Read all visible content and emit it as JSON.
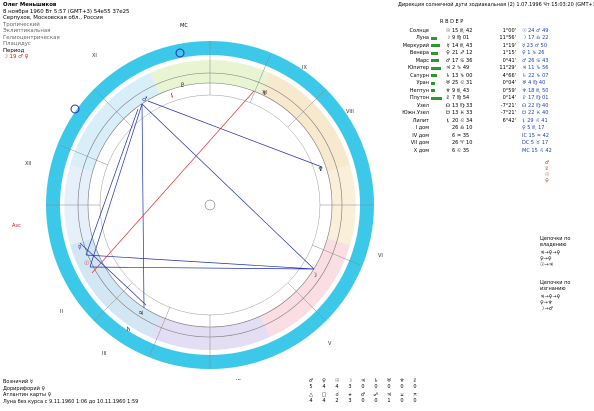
{
  "header": {
    "name": "Олег Меньшиков",
    "line1": "8 ноября 1960  Вт  5:57 (GMT+3) 54е55 37е25",
    "line2": "Серпухов, Московская обл., Россия",
    "meta": [
      "Тропический",
      "Эклиптикальная",
      "Гелиоцентрическая",
      "Плацидус"
    ],
    "period_label": "Период",
    "period_value": "☽ 19 ♂ ♀"
  },
  "subtitle": "Дирекция солнечной дуги зодиакальная (2)  1.07.1996  Чт 15:03:20 (GMT+3)",
  "planets": [
    {
      "name": "Солнце",
      "sym": "☉",
      "pos": "15 ♏ 42",
      "speed": "1°00'",
      "ruler": "☉ 24 ♂ 49",
      "bar": 0
    },
    {
      "name": "Луна",
      "sym": "☽",
      "pos": "9 ♍ 01",
      "speed": "11°56'",
      "ruler": "☽ 17 ♎ 22",
      "bar": 0.5
    },
    {
      "name": "Меркурий",
      "sym": "☿",
      "pos": "14 ♏ 43",
      "speed": "1°19'",
      "ruler": "☿ 23 ♂ 50",
      "bar": 0.8
    },
    {
      "name": "Венера",
      "sym": "♀",
      "pos": "21 ♐ 12",
      "speed": "1°15'",
      "ruler": "♀ 1 ♑ 26",
      "bar": 0.6
    },
    {
      "name": "Марс",
      "sym": "♂",
      "pos": "17 ♋ 36",
      "speed": "0°41'",
      "ruler": "♂ 26 ♋ 43",
      "bar": 0.7
    },
    {
      "name": "Юпитер",
      "sym": "♃",
      "pos": "2 ♑ 49",
      "speed": "11°29'",
      "ruler": "♃ 11 ♑ 56",
      "bar": 0.9
    },
    {
      "name": "Сатурн",
      "sym": "♄",
      "pos": "13 ♑ 00",
      "speed": "4°66'",
      "ruler": "♄ 22 ♑ 07",
      "bar": 0.5
    },
    {
      "name": "Уран",
      "sym": "♅",
      "pos": "25 ♌ 31",
      "speed": "0°04'",
      "ruler": "♅ 4 ♍ 40",
      "bar": 0.4
    },
    {
      "name": "Нептун",
      "sym": "♆",
      "pos": "9 ♏ 43",
      "speed": "0°59'",
      "ruler": "♆ 18 ♏ 50",
      "bar": 0.4
    },
    {
      "name": "Плутон",
      "sym": "♇",
      "pos": "7 ♍ 54",
      "speed": "0°14'",
      "ruler": "♇ 17 ♍ 01",
      "bar": 1.0
    },
    {
      "name": "Узел",
      "sym": "☊",
      "pos": "13 ♍ 33",
      "speed": "-7°21'",
      "ruler": "☊ 22 ♍ 40",
      "bar": 0
    },
    {
      "name": "Южн.Узел",
      "sym": "☋",
      "pos": "13 ♓ 33",
      "speed": "-7°21'",
      "ruler": "☋ 22 ♓ 40",
      "bar": 0
    },
    {
      "name": "Лилит",
      "sym": "⚸",
      "pos": "20 ♌ 34",
      "speed": "6°42'",
      "ruler": "⚸ 29 ♌ 41",
      "bar": 0
    },
    {
      "name": "I дом",
      "sym": "",
      "pos": "26 ♎ 10",
      "speed": "",
      "ruler": "♀ 5 ♏ 17",
      "bar": 0
    },
    {
      "name": "IV дом",
      "sym": "",
      "pos": "6 ♒ 35",
      "speed": "",
      "ruler": "IC 15 ♒ 42",
      "bar": 0
    },
    {
      "name": "VII дом",
      "sym": "",
      "pos": "26 ♈ 10",
      "speed": "",
      "ruler": "DC 5 ♉ 17",
      "bar": 0
    },
    {
      "name": "X дом",
      "sym": "",
      "pos": "6 ♌ 35",
      "speed": "",
      "ruler": "MC 15 ♌ 42",
      "bar": 0
    }
  ],
  "col_headers": "R  B  D  E  P",
  "chains": {
    "title1": "Цепочки по владению",
    "title2": "Цепочки по изгнанию"
  },
  "bottom_left": [
    "Возничий ☿",
    "Доририфорий ♀",
    "Атлантин карты ♀",
    "Луна без курса с 9.11.1960 1:06 до 10.11.1960 1:59"
  ],
  "bottom_grid": {
    "row1_syms": [
      "♂",
      "♀",
      "☉",
      "☽",
      "♃",
      "♄",
      "♅",
      "♆",
      "♇"
    ],
    "row1_vals": [
      "5",
      "4",
      "4",
      "3",
      "0",
      "0",
      "0",
      "0",
      "0"
    ],
    "row2_syms": [
      "△",
      "□",
      "☌",
      "⚹",
      "♂",
      "☍",
      "♃",
      "⚺",
      "⚻"
    ],
    "row2_vals": [
      "4",
      "4",
      "2",
      "3",
      "0",
      "0",
      "1",
      "0",
      "0"
    ]
  },
  "chart_labels": {
    "asc": "Asc",
    "mc": "MC",
    "ic": "IC",
    "houses": [
      "I",
      "II",
      "III",
      "IV",
      "V",
      "VI",
      "VII",
      "VIII",
      "IX",
      "X",
      "XI",
      "XII"
    ]
  },
  "colors": {
    "outer_ring": "#3cc8e8",
    "aspect_red": "#e03030",
    "aspect_blue": "#2030b0"
  }
}
